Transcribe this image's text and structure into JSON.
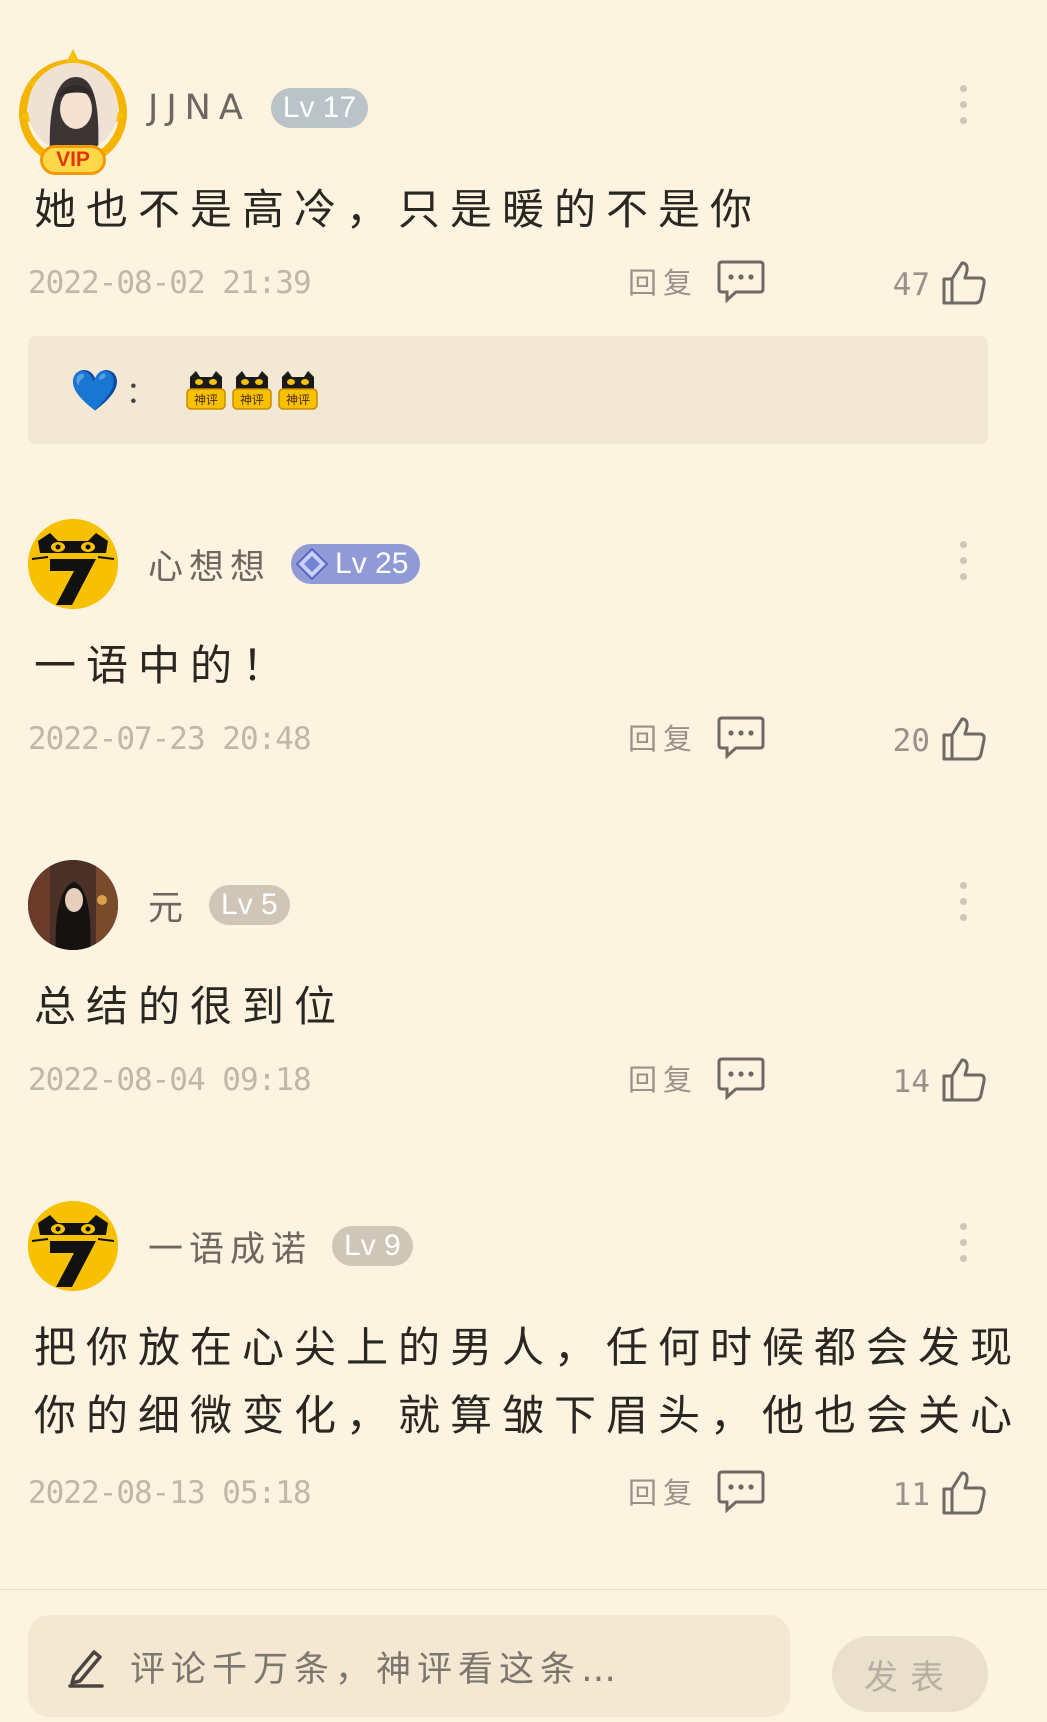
{
  "comments": [
    {
      "username": "JJNA",
      "level": "Lv 17",
      "vip_label": "VIP",
      "text_lines": [
        "她也不是高冷，只是暖的不是你"
      ],
      "date": "2022-08-02 21:39",
      "reply_label": "回复",
      "likes": "47",
      "quote": {
        "emoji": "💙",
        "colon": "：",
        "badge_text": "神评",
        "badge_count": 3
      }
    },
    {
      "username": "心想想",
      "level": "Lv 25",
      "text_lines": [
        "一语中的！"
      ],
      "date": "2022-07-23 20:48",
      "reply_label": "回复",
      "likes": "20"
    },
    {
      "username": "元",
      "level": "Lv 5",
      "text_lines": [
        "总结的很到位"
      ],
      "date": "2022-08-04 09:18",
      "reply_label": "回复",
      "likes": "14"
    },
    {
      "username": "一语成诺",
      "level": "Lv 9",
      "text_lines": [
        "把你放在心尖上的男人，任何时候都会发现",
        "你的细微变化，就算皱下眉头，他也会关心"
      ],
      "date": "2022-08-13 05:18",
      "reply_label": "回复",
      "likes": "11"
    }
  ],
  "composer": {
    "placeholder": "评论千万条，神评看这条…",
    "send_label": "发表"
  },
  "colors": {
    "background": "#fdf3e1",
    "level_17": "#b9c3c8",
    "level_25": "#8f9ad6",
    "level_low": "#cfc6b8",
    "mascot_yellow": "#f7c100"
  },
  "icons": [
    "more-icon",
    "comment-bubble-icon",
    "thumbs-up-icon",
    "pencil-icon",
    "crown-icon"
  ]
}
